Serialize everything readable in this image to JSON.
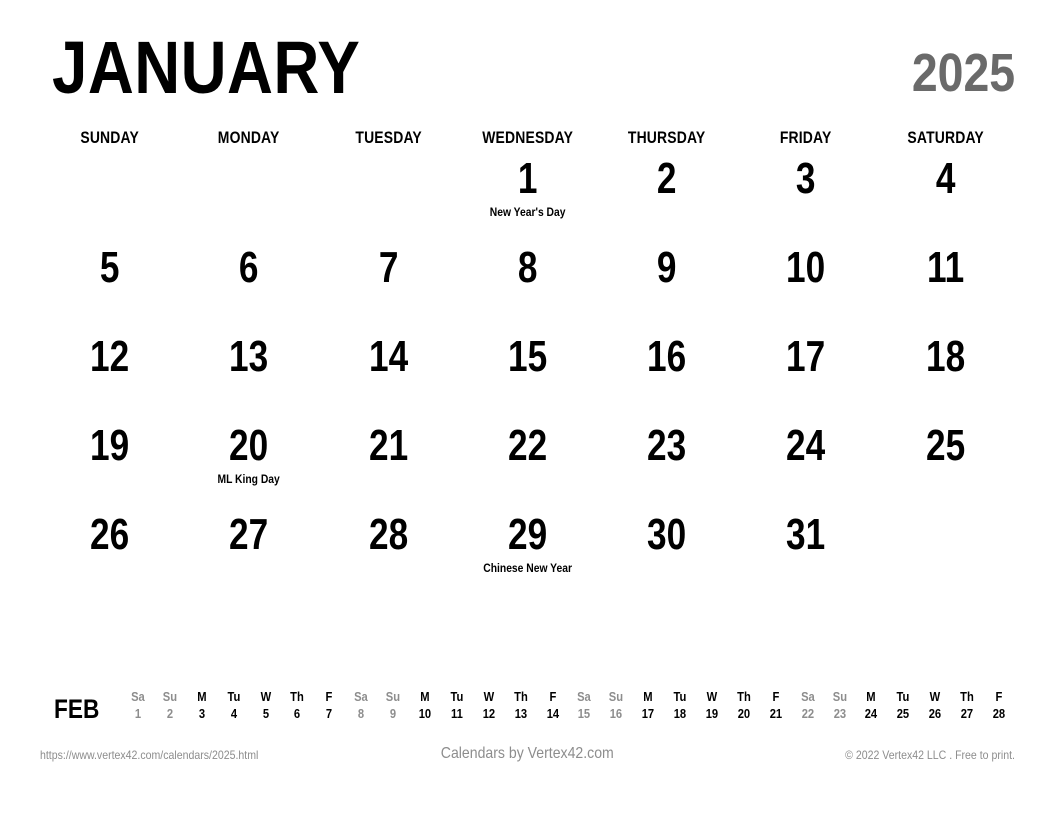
{
  "header": {
    "month": "JANUARY",
    "year": "2025"
  },
  "colors": {
    "text": "#000000",
    "muted": "#8d8d8d",
    "year": "#6a6a6a",
    "background": "#ffffff"
  },
  "weekdays": [
    "SUNDAY",
    "MONDAY",
    "TUESDAY",
    "WEDNESDAY",
    "THURSDAY",
    "FRIDAY",
    "SATURDAY"
  ],
  "weeks": [
    [
      {
        "date": "",
        "event": ""
      },
      {
        "date": "",
        "event": ""
      },
      {
        "date": "",
        "event": ""
      },
      {
        "date": "1",
        "event": "New Year's Day"
      },
      {
        "date": "2",
        "event": ""
      },
      {
        "date": "3",
        "event": ""
      },
      {
        "date": "4",
        "event": ""
      }
    ],
    [
      {
        "date": "5",
        "event": ""
      },
      {
        "date": "6",
        "event": ""
      },
      {
        "date": "7",
        "event": ""
      },
      {
        "date": "8",
        "event": ""
      },
      {
        "date": "9",
        "event": ""
      },
      {
        "date": "10",
        "event": ""
      },
      {
        "date": "11",
        "event": ""
      }
    ],
    [
      {
        "date": "12",
        "event": ""
      },
      {
        "date": "13",
        "event": ""
      },
      {
        "date": "14",
        "event": ""
      },
      {
        "date": "15",
        "event": ""
      },
      {
        "date": "16",
        "event": ""
      },
      {
        "date": "17",
        "event": ""
      },
      {
        "date": "18",
        "event": ""
      }
    ],
    [
      {
        "date": "19",
        "event": ""
      },
      {
        "date": "20",
        "event": "ML King Day"
      },
      {
        "date": "21",
        "event": ""
      },
      {
        "date": "22",
        "event": ""
      },
      {
        "date": "23",
        "event": ""
      },
      {
        "date": "24",
        "event": ""
      },
      {
        "date": "25",
        "event": ""
      }
    ],
    [
      {
        "date": "26",
        "event": ""
      },
      {
        "date": "27",
        "event": ""
      },
      {
        "date": "28",
        "event": ""
      },
      {
        "date": "29",
        "event": "Chinese New Year"
      },
      {
        "date": "30",
        "event": ""
      },
      {
        "date": "31",
        "event": ""
      },
      {
        "date": "",
        "event": ""
      }
    ]
  ],
  "next_month_strip": {
    "label": "FEB",
    "days": [
      {
        "dow": "Sa",
        "date": "1",
        "weekend": true
      },
      {
        "dow": "Su",
        "date": "2",
        "weekend": true
      },
      {
        "dow": "M",
        "date": "3",
        "weekend": false
      },
      {
        "dow": "Tu",
        "date": "4",
        "weekend": false
      },
      {
        "dow": "W",
        "date": "5",
        "weekend": false
      },
      {
        "dow": "Th",
        "date": "6",
        "weekend": false
      },
      {
        "dow": "F",
        "date": "7",
        "weekend": false
      },
      {
        "dow": "Sa",
        "date": "8",
        "weekend": true
      },
      {
        "dow": "Su",
        "date": "9",
        "weekend": true
      },
      {
        "dow": "M",
        "date": "10",
        "weekend": false
      },
      {
        "dow": "Tu",
        "date": "11",
        "weekend": false
      },
      {
        "dow": "W",
        "date": "12",
        "weekend": false
      },
      {
        "dow": "Th",
        "date": "13",
        "weekend": false
      },
      {
        "dow": "F",
        "date": "14",
        "weekend": false
      },
      {
        "dow": "Sa",
        "date": "15",
        "weekend": true
      },
      {
        "dow": "Su",
        "date": "16",
        "weekend": true
      },
      {
        "dow": "M",
        "date": "17",
        "weekend": false
      },
      {
        "dow": "Tu",
        "date": "18",
        "weekend": false
      },
      {
        "dow": "W",
        "date": "19",
        "weekend": false
      },
      {
        "dow": "Th",
        "date": "20",
        "weekend": false
      },
      {
        "dow": "F",
        "date": "21",
        "weekend": false
      },
      {
        "dow": "Sa",
        "date": "22",
        "weekend": true
      },
      {
        "dow": "Su",
        "date": "23",
        "weekend": true
      },
      {
        "dow": "M",
        "date": "24",
        "weekend": false
      },
      {
        "dow": "Tu",
        "date": "25",
        "weekend": false
      },
      {
        "dow": "W",
        "date": "26",
        "weekend": false
      },
      {
        "dow": "Th",
        "date": "27",
        "weekend": false
      },
      {
        "dow": "F",
        "date": "28",
        "weekend": false
      }
    ]
  },
  "footer": {
    "url": "https://www.vertex42.com/calendars/2025.html",
    "credit": "Calendars by Vertex42.com",
    "copyright": "© 2022 Vertex42 LLC . Free to print."
  }
}
